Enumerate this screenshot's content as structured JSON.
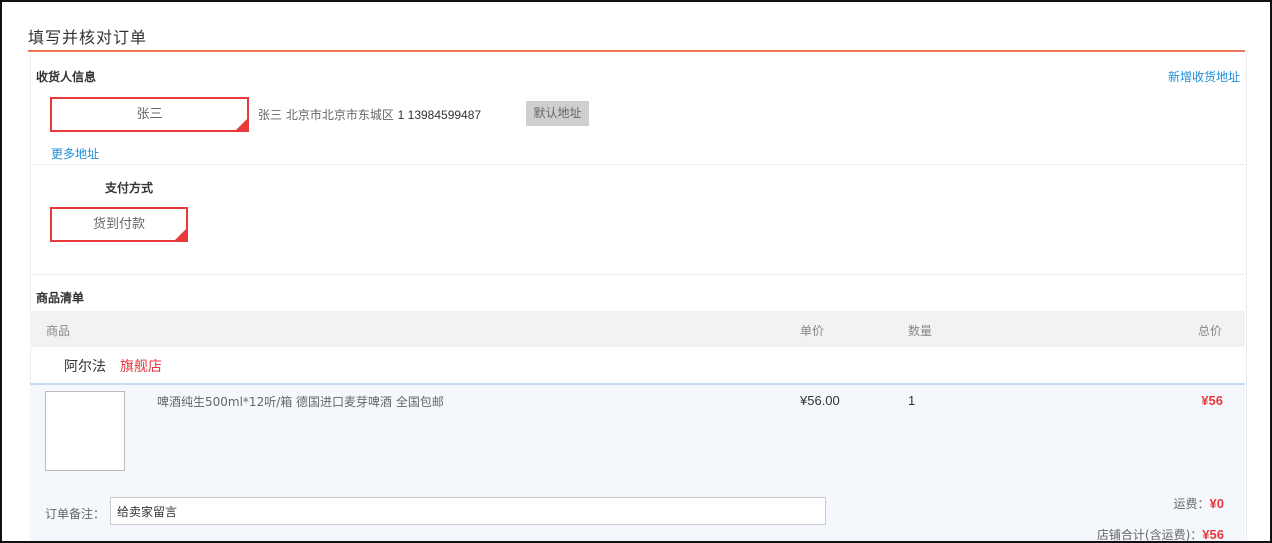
{
  "page": {
    "title": "填写并核对订单"
  },
  "consignee": {
    "section_label": "收货人信息",
    "add_address_link": "新增收货地址",
    "selected_name": "张三",
    "address_detail": "张三  北京市北京市东城区",
    "address_phone": "1  13984599487",
    "default_badge": "默认地址",
    "more_address_link": "更多地址"
  },
  "payment": {
    "section_label": "支付方式",
    "selected_method": "货到付款"
  },
  "goods": {
    "section_label": "商品清单",
    "columns": {
      "product": "商品",
      "unit_price": "单价",
      "quantity": "数量",
      "total": "总价"
    },
    "shop": {
      "name": "阿尔法",
      "tag": "旗舰店"
    },
    "items": [
      {
        "name": "啤酒纯生500ml*12听/箱 德国进口麦芽啤酒 全国包邮",
        "unit_price": "¥56.00",
        "quantity": "1",
        "total": "¥56"
      }
    ],
    "remark": {
      "label": "订单备注：",
      "value": "给卖家留言"
    },
    "shipping": {
      "label": "运费：",
      "amount": "¥0"
    },
    "shop_total": {
      "label": "店铺合计(含运费)：",
      "amount": "¥56"
    }
  },
  "colors": {
    "accent_red": "#e8393d",
    "link_blue": "#1a8fd8",
    "title_rule": "#f2775a"
  }
}
